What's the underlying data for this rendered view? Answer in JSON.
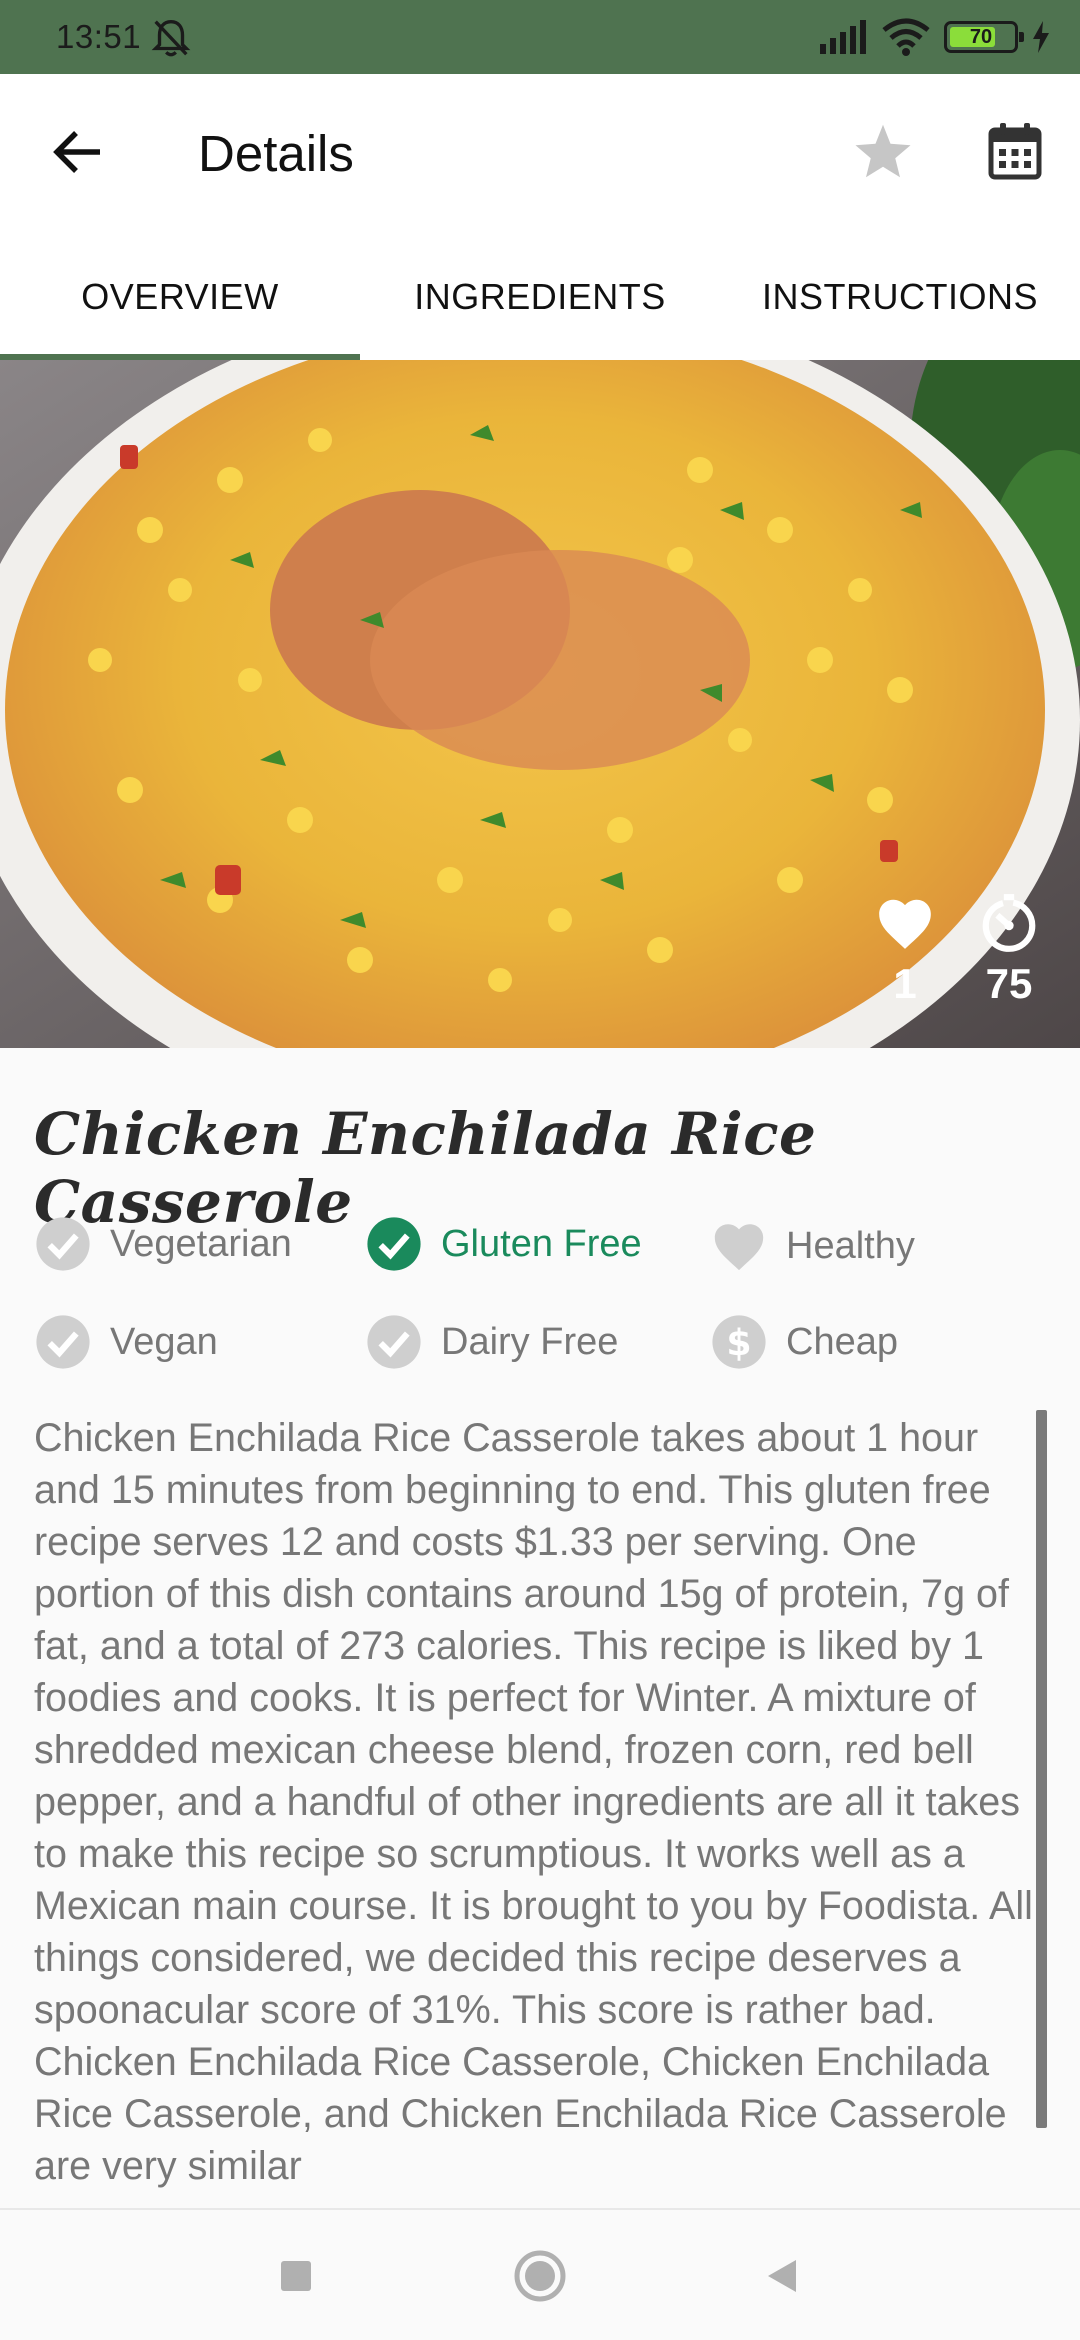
{
  "status_bar": {
    "time": "13:51",
    "battery_level": "70",
    "battery_percent": 70
  },
  "toolbar": {
    "title": "Details",
    "back_icon": "arrow-left-icon",
    "favorite_icon": "star-icon",
    "calendar_icon": "calendar-icon"
  },
  "tabs": [
    {
      "label": "OVERVIEW",
      "selected": true
    },
    {
      "label": "INGREDIENTS",
      "selected": false
    },
    {
      "label": "INSTRUCTIONS",
      "selected": false
    }
  ],
  "hero": {
    "likes": "1",
    "minutes": "75"
  },
  "recipe": {
    "title": "Chicken Enchilada Rice Casserole",
    "badges": [
      {
        "label": "Vegetarian",
        "icon": "check-circle-icon",
        "active": false
      },
      {
        "label": "Gluten Free",
        "icon": "check-circle-icon",
        "active": true
      },
      {
        "label": "Healthy",
        "icon": "heart-icon",
        "active": false
      },
      {
        "label": "Vegan",
        "icon": "check-circle-icon",
        "active": false
      },
      {
        "label": "Dairy Free",
        "icon": "check-circle-icon",
        "active": false
      },
      {
        "label": "Cheap",
        "icon": "dollar-circle-icon",
        "active": false
      }
    ],
    "summary": "Chicken Enchilada Rice Casserole takes about 1 hour and 15 minutes from beginning to end. This gluten free recipe serves 12 and costs $1.33 per serving. One portion of this dish contains around 15g of protein, 7g of fat, and a total of 273 calories. This recipe is liked by 1 foodies and cooks. It is perfect for Winter. A mixture of shredded mexican cheese blend, frozen corn, red bell pepper, and a handful of other ingredients are all it takes to make this recipe so scrumptious. It works well as a Mexican main course. It is brought to you by Foodista. All things considered, we decided this recipe deserves a spoonacular score of 31%. This score is rather bad. Chicken Enchilada Rice Casserole, Chicken Enchilada Rice Casserole, and Chicken Enchilada Rice Casserole are very similar"
  },
  "colors": {
    "primary": "#4f7350",
    "active_badge": "#1a8a5c",
    "inactive_badge": "#c4c4c4"
  }
}
